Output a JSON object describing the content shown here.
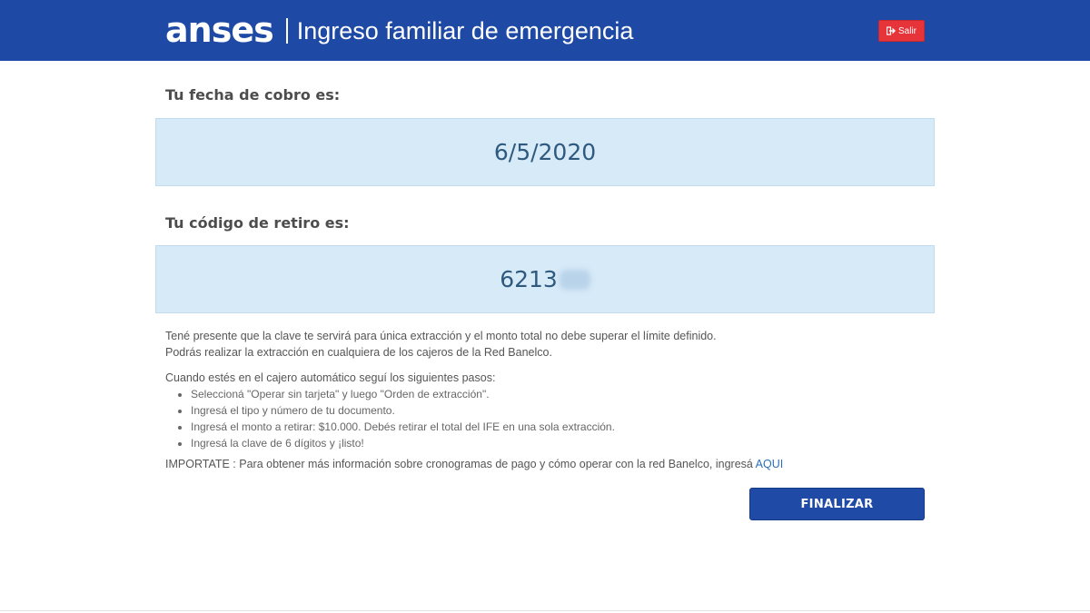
{
  "header": {
    "logo": "anses",
    "title": "Ingreso familiar de emergencia",
    "exit_label": "Salir",
    "exit_icon": "exit-icon",
    "background_color": "#1e4aa5",
    "exit_color": "#e6343a"
  },
  "payment": {
    "date_label": "Tu fecha de cobro es:",
    "date_value": "6/5/2020",
    "code_label": "Tu código de retiro es:",
    "code_value": "6213"
  },
  "info": {
    "line1": "Tené presente que la clave te servirá para única extracción y el monto total no debe superar el límite definido.",
    "line2": "Podrás realizar la extracción en cualquiera de los cajeros de la Red Banelco.",
    "steps_intro": "Cuando estés en el cajero automático seguí los siguientes pasos:",
    "steps": [
      "Seleccioná \"Operar sin tarjeta\" y luego \"Orden de extracción\".",
      "Ingresá el tipo y número de tu documento.",
      "Ingresá el monto a retirar: $10.000. Debés retirar el total del IFE en una sola extracción.",
      "Ingresá la clave de 6 dígitos y ¡listo!"
    ],
    "important_text": "IMPORTATE : Para obtener más información sobre cronogramas de pago y cómo operar con la red Banelco, ingresá ",
    "important_link": "AQUI"
  },
  "actions": {
    "finish_label": "FINALIZAR",
    "button_color": "#1f4ba6"
  }
}
